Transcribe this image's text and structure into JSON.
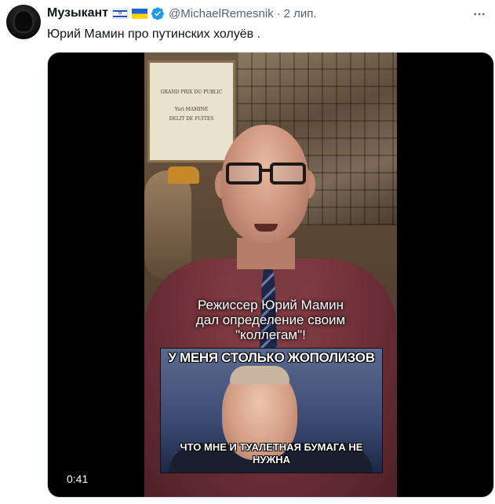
{
  "tweet": {
    "display_name": "Музыкант",
    "flags": [
      "israel-flag",
      "ukraine-flag"
    ],
    "verified": true,
    "handle": "@MichaelRemesnik",
    "separator": "·",
    "time": "2 лип.",
    "text": "Юрий Мамин про путинских холуёв ."
  },
  "media": {
    "type": "video",
    "duration": "0:41",
    "overlay_caption": "Режиссер Юрий Мамин\nдал определение своим\n\"коллегам\"!",
    "meme_top_text": "У МЕНЯ СТОЛЬКО ЖОПОЛИЗОВ",
    "meme_bottom_text": "ЧТО МНЕ И ТУАЛЕТНАЯ БУМАГА НЕ\nНУЖНА",
    "diploma_lines": [
      "GRAND PRIX DU PUBLIC",
      "Yuri MAMINE",
      "DELIT DE FUITES"
    ]
  },
  "colors": {
    "name": "#0f1419",
    "secondary": "#536471",
    "verified": "#1d9bf0"
  }
}
